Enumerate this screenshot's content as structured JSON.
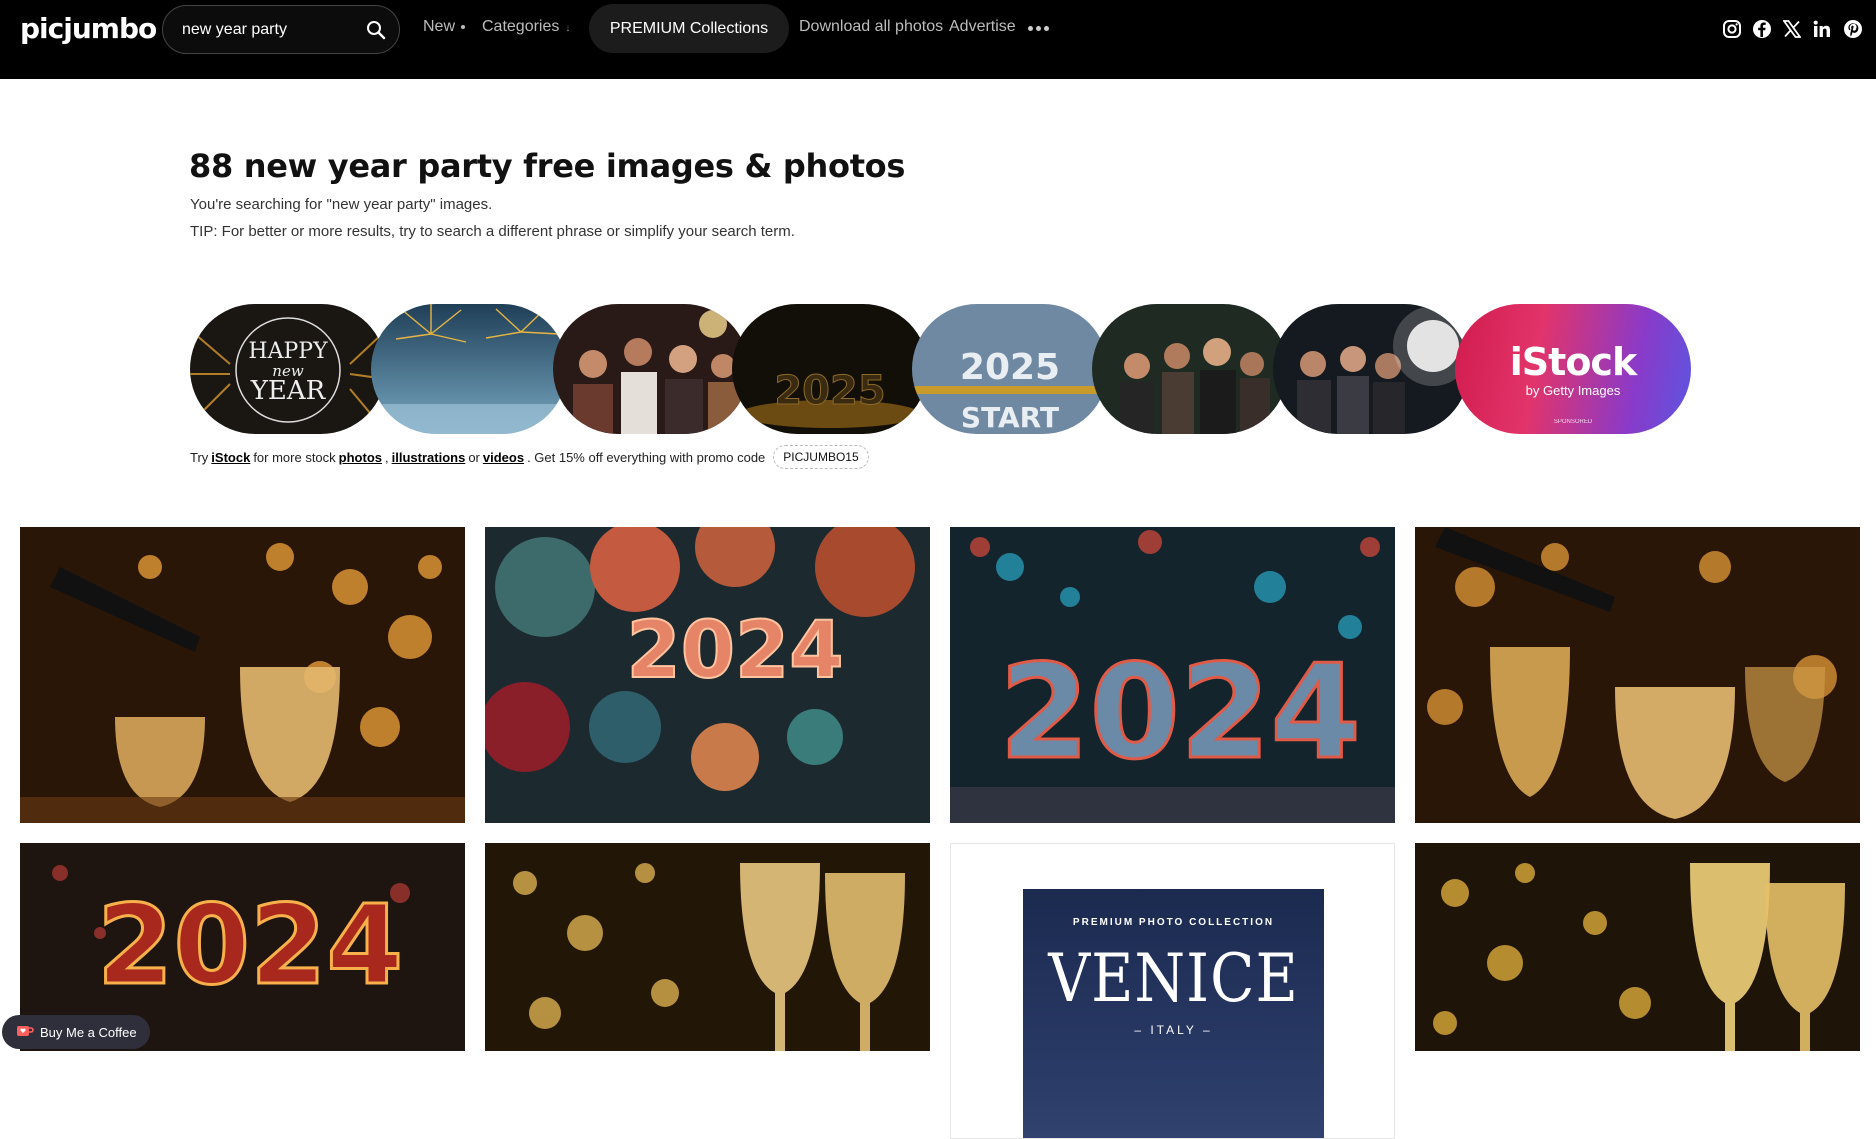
{
  "header": {
    "logo": "picjumbo",
    "search_value": "new year party",
    "nav": {
      "new": "New",
      "categories": "Categories",
      "premium": "PREMIUM Collections",
      "download_all": "Download all photos",
      "advertise": "Advertise"
    },
    "social": [
      "instagram-icon",
      "facebook-icon",
      "x-icon",
      "linkedin-icon",
      "pinterest-icon"
    ]
  },
  "heading": {
    "title": "88 new year party free images & photos",
    "searching": "You're searching for \"new year party\" images.",
    "tip": "TIP: For better or more results, try to search a different phrase or simplify your search term."
  },
  "thumbnails": {
    "happy_new_year": {
      "line1": "HAPPY",
      "line2": "new",
      "line3": "YEAR"
    },
    "start_2025": {
      "year": "2025",
      "word": "START"
    },
    "istock": {
      "name": "iStock",
      "by": "by Getty Images",
      "sponsored": "SPONSORED"
    }
  },
  "promo": {
    "try": "Try",
    "istock": "iStock",
    "for_more": "for more stock",
    "photos": "photos",
    "illustrations": "illustrations",
    "or": "or",
    "videos": "videos",
    "discount": ". Get 15% off everything with promo code",
    "code": "PICJUMBO15"
  },
  "grid": {
    "photo2_text": "2024",
    "photo3_text": "2024",
    "photo5_text": "2024",
    "venice": {
      "kicker": "PREMIUM PHOTO COLLECTION",
      "name": "VENICE",
      "sub": "– ITALY –"
    }
  },
  "bmc": {
    "label": "Buy Me a Coffee"
  },
  "colors": {
    "header_bg": "#000000",
    "istock_gradient_start": "#d11b4d",
    "istock_gradient_end": "#5b56e0"
  }
}
